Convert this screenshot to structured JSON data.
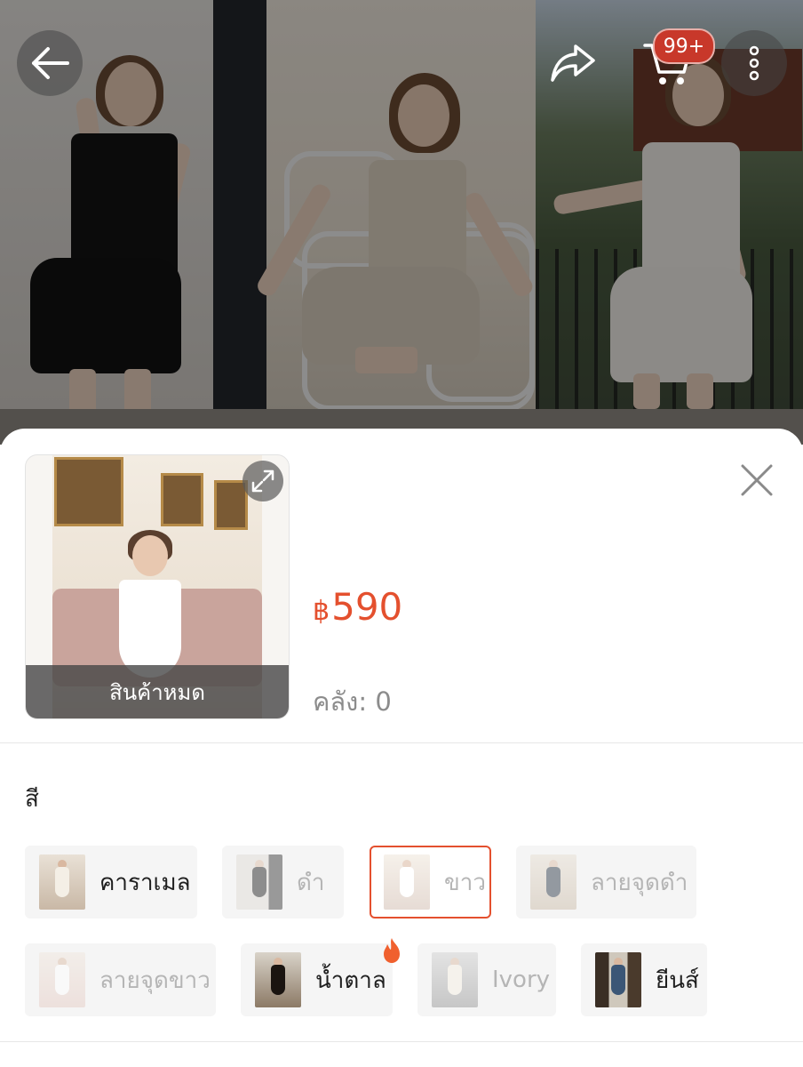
{
  "top_bar": {
    "cart_badge": "99+"
  },
  "product": {
    "thumbnail_overlay": "สินค้าหมด",
    "currency_symbol": "฿",
    "price": "590",
    "stock_text": "คลัง: 0"
  },
  "variations": {
    "label": "สี",
    "options": [
      {
        "label": "คาราเมล",
        "state": "available"
      },
      {
        "label": "ดำ",
        "state": "unavailable"
      },
      {
        "label": "ขาว",
        "state": "selected"
      },
      {
        "label": "ลายจุดดำ",
        "state": "unavailable"
      },
      {
        "label": "ลายจุดขาว",
        "state": "unavailable"
      },
      {
        "label": "น้ำตาล",
        "state": "available",
        "badge": "fire-icon"
      },
      {
        "label": "Ivory",
        "state": "unavailable"
      },
      {
        "label": "ยีนส์",
        "state": "available"
      }
    ]
  },
  "colors": {
    "accent": "#e4502e",
    "badge": "#c8382a"
  }
}
